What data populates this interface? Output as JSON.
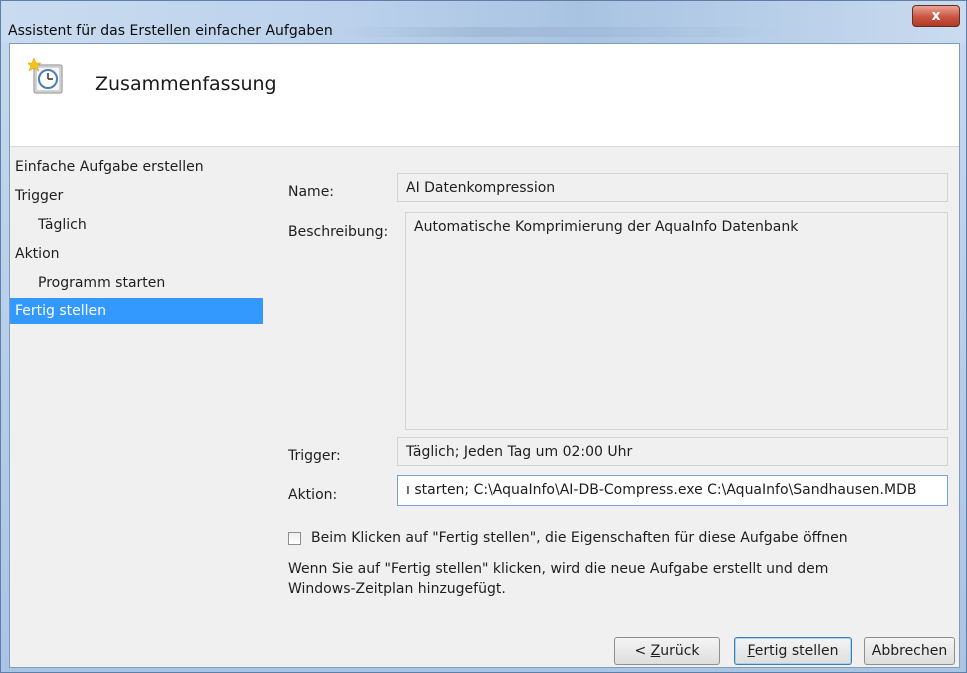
{
  "window": {
    "title": "Assistent für das Erstellen einfacher Aufgaben",
    "close_glyph": "x"
  },
  "header": {
    "title": "Zusammenfassung",
    "icon": "clock-icon"
  },
  "nav": {
    "items": [
      {
        "label": "Einfache Aufgabe erstellen"
      },
      {
        "label": "Trigger"
      },
      {
        "label": "Täglich"
      },
      {
        "label": "Aktion"
      },
      {
        "label": "Programm starten"
      },
      {
        "label": "Fertig stellen"
      }
    ],
    "selected": "Fertig stellen"
  },
  "summary": {
    "name_label": "Name:",
    "name_value": "AI Datenkompression",
    "description_label": "Beschreibung:",
    "description_value": "Automatische Komprimierung der AquaInfo Datenbank",
    "trigger_label": "Trigger:",
    "trigger_value": "Täglich; Jeden Tag um 02:00 Uhr",
    "action_label": "Aktion:",
    "action_value": "ı starten; C:\\AquaInfo\\AI-DB-Compress.exe C:\\AquaInfo\\Sandhausen.MDB"
  },
  "options": {
    "open_properties_label": "Beim Klicken auf \"Fertig stellen\", die Eigenschaften für diese Aufgabe öffnen",
    "open_properties_checked": false,
    "info_line1": "Wenn Sie auf \"Fertig stellen\" klicken, wird die neue Aufgabe erstellt und dem",
    "info_line2": "Windows-Zeitplan hinzugefügt."
  },
  "buttons": {
    "back_prefix": "< ",
    "back_mnemonic": "Z",
    "back_rest": "urück",
    "finish_mnemonic": "F",
    "finish_rest": "ertig stellen",
    "cancel": "Abbrechen"
  }
}
